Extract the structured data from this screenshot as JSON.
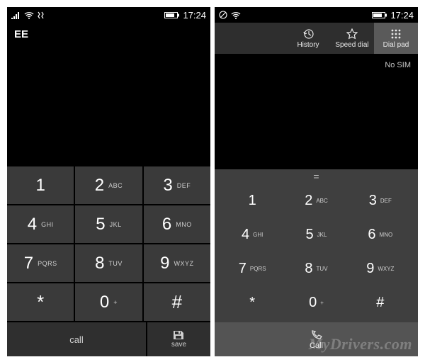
{
  "watermark": "MyDrivers.com",
  "left": {
    "statusbar": {
      "time": "17:24"
    },
    "carrier": "EE",
    "keys": [
      {
        "d": "1",
        "l": ""
      },
      {
        "d": "2",
        "l": "ABC"
      },
      {
        "d": "3",
        "l": "DEF"
      },
      {
        "d": "4",
        "l": "GHI"
      },
      {
        "d": "5",
        "l": "JKL"
      },
      {
        "d": "6",
        "l": "MNO"
      },
      {
        "d": "7",
        "l": "PQRS"
      },
      {
        "d": "8",
        "l": "TUV"
      },
      {
        "d": "9",
        "l": "WXYZ"
      },
      {
        "d": "*",
        "l": ""
      },
      {
        "d": "0",
        "l": "+"
      },
      {
        "d": "#",
        "l": ""
      }
    ],
    "call_label": "call",
    "save_label": "save"
  },
  "right": {
    "statusbar": {
      "time": "17:24"
    },
    "tabs": {
      "history": "History",
      "speed": "Speed dial",
      "dialpad": "Dial pad"
    },
    "nosim": "No SIM",
    "display": "=",
    "keys": [
      {
        "d": "1",
        "l": ""
      },
      {
        "d": "2",
        "l": "ABC"
      },
      {
        "d": "3",
        "l": "DEF"
      },
      {
        "d": "4",
        "l": "GHI"
      },
      {
        "d": "5",
        "l": "JKL"
      },
      {
        "d": "6",
        "l": "MNO"
      },
      {
        "d": "7",
        "l": "PQRS"
      },
      {
        "d": "8",
        "l": "TUV"
      },
      {
        "d": "9",
        "l": "WXYZ"
      },
      {
        "d": "*",
        "l": ""
      },
      {
        "d": "0",
        "l": "+"
      },
      {
        "d": "#",
        "l": ""
      }
    ],
    "call_label": "Call"
  }
}
